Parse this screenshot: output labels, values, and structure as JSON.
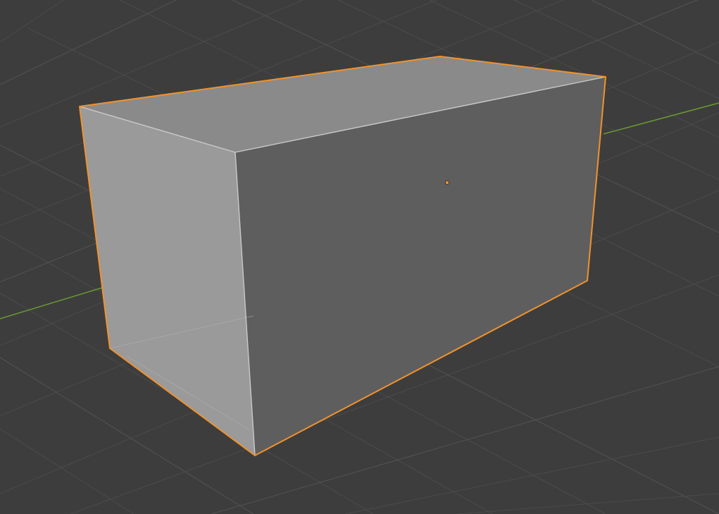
{
  "viewport": {
    "view": "3d-viewport",
    "grid_visible": true,
    "object": {
      "kind": "box",
      "selected": true,
      "shading": "solid"
    },
    "colors": {
      "background": "#3d3d3d",
      "grid": "#4b4b4b",
      "y_axis": "#6a9a32",
      "selection_outline": "#f0922e",
      "origin_point": "#f0922e",
      "face_left": "#9a9a9a",
      "face_top": "#8a8a8a",
      "face_front": "#5e5e5e"
    }
  }
}
